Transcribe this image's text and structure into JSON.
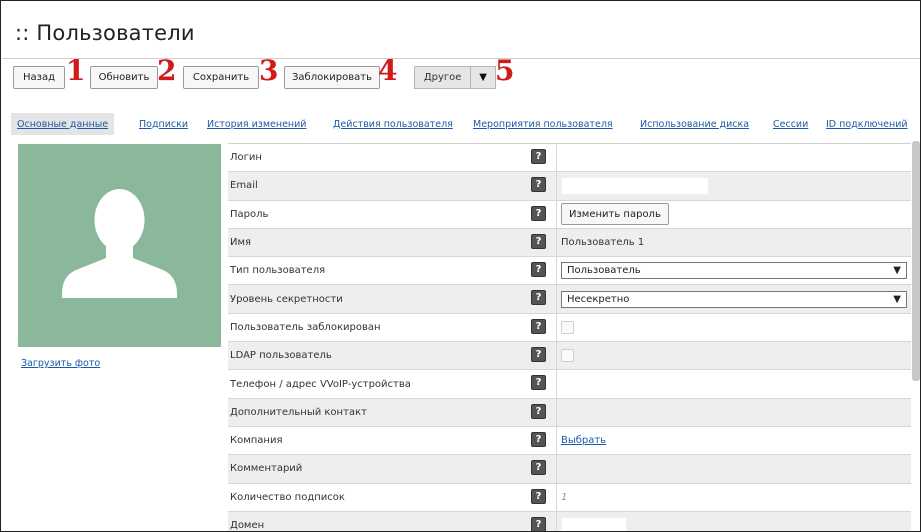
{
  "page": {
    "title": ":: Пользователи"
  },
  "toolbar": {
    "back": "Назад",
    "refresh": "Обновить",
    "save": "Сохранить",
    "block": "Заблокировать",
    "other": "Другое",
    "other_arrow": "▼"
  },
  "annotations": [
    "1",
    "2",
    "3",
    "4",
    "5"
  ],
  "tabs": [
    "Основные данные",
    "Подписки",
    "История изменений",
    "Действия пользователя",
    "Мероприятия пользователя",
    "Использование диска",
    "Сессии",
    "ID подключений"
  ],
  "photo": {
    "upload_link": "Загрузить фото",
    "icon": "user-silhouette-icon"
  },
  "help_glyph": "?",
  "form": {
    "login": {
      "label": "Логин"
    },
    "email": {
      "label": "Email"
    },
    "password": {
      "label": "Пароль",
      "button": "Изменить пароль"
    },
    "name": {
      "label": "Имя",
      "value": "Пользователь 1"
    },
    "user_type": {
      "label": "Тип пользователя",
      "value": "Пользователь"
    },
    "secrecy": {
      "label": "Уровень секретности",
      "value": "Несекретно"
    },
    "blocked": {
      "label": "Пользователь заблокирован",
      "checked": false
    },
    "ldap": {
      "label": "LDAP пользователь",
      "checked": false
    },
    "phone": {
      "label": "Телефон / адрес VVoIP-устройства"
    },
    "extra_contact": {
      "label": "Дополнительный контакт"
    },
    "company": {
      "label": "Компания",
      "link": "Выбрать"
    },
    "comment": {
      "label": "Комментарий"
    },
    "subscriptions": {
      "label": "Количество подписок",
      "value": "1"
    },
    "domain": {
      "label": "Домен"
    }
  },
  "colors": {
    "link": "#1a5aa8",
    "annotation": "#d11a1a",
    "photo_bg": "#8bb89a"
  }
}
